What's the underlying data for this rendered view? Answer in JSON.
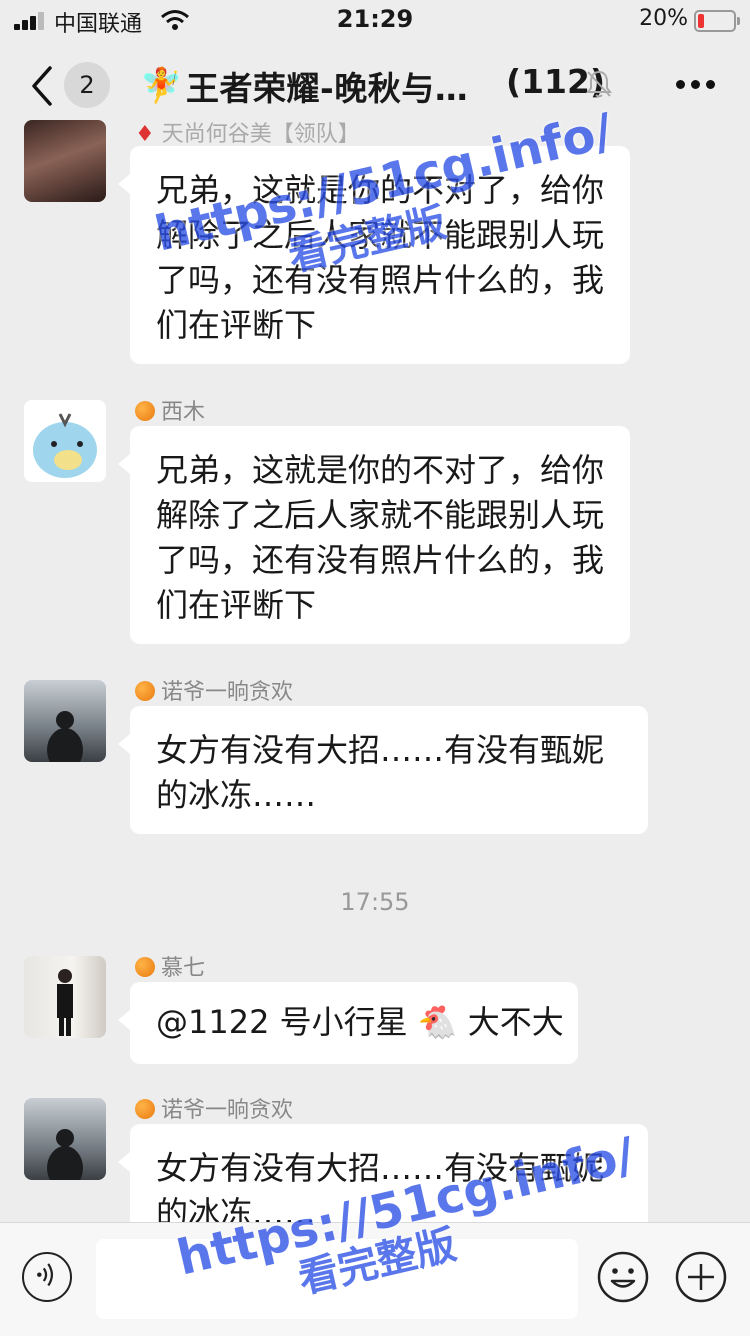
{
  "status_bar": {
    "carrier": "中国联通",
    "time": "21:29",
    "battery": "20%"
  },
  "nav": {
    "back_count": "2",
    "title": "王者荣耀-晚秋与…",
    "member_count": "(112)"
  },
  "messages": [
    {
      "sender": "天尚何谷美【领队】",
      "text": "兄弟，这就是你的不对了，给你解除了之后人家就不能跟别人玩了吗，还有没有照片什么的，我们在评断下"
    },
    {
      "sender": "西木",
      "text": "兄弟，这就是你的不对了，给你解除了之后人家就不能跟别人玩了吗，还有没有照片什么的，我们在评断下"
    },
    {
      "sender": "诺爷一晌贪欢",
      "text": "女方有没有大招……有没有甄妮的冰冻……"
    },
    {
      "sender": "慕七",
      "text": "@1122 号小行星 🐔 大不大"
    },
    {
      "sender": "诺爷一晌贪欢",
      "text": "女方有没有大招……有没有甄妮的冰冻……"
    }
  ],
  "time_separator": "17:55",
  "watermark": {
    "url": "https://51cg.info/",
    "caption": "看完整版"
  },
  "colors": {
    "background": "#ededed",
    "bubble": "#ffffff",
    "watermark": "#2d50e6",
    "battery_low": "#e33333"
  }
}
